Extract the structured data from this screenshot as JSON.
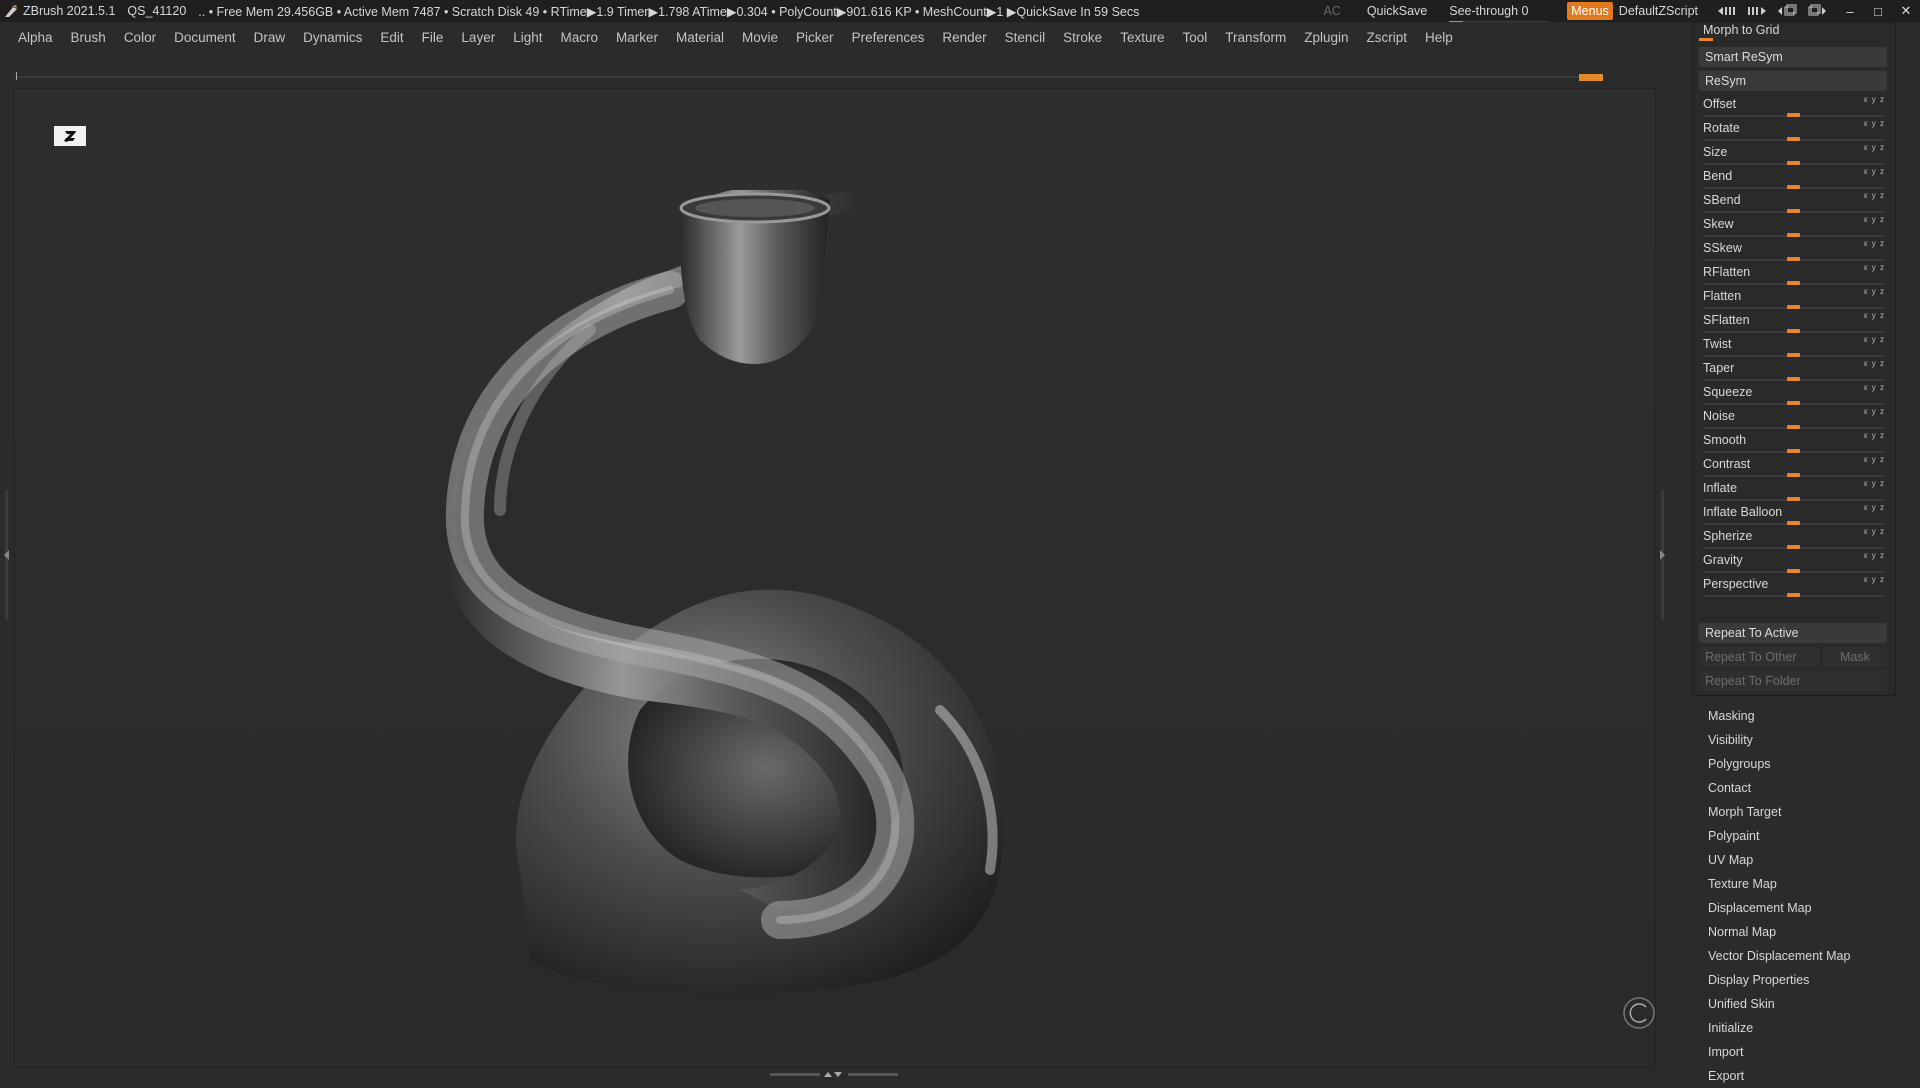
{
  "titlebar": {
    "app": "ZBrush 2021.5.1",
    "qs": "QS_41120",
    "stats": ".. • Free Mem 29.456GB • Active Mem 7487 • Scratch Disk 49 •  RTime▶1.9 Timer▶1.798 ATime▶0.304 • PolyCount▶901.616 KP  • MeshCount▶1  ▶QuickSave In 59 Secs",
    "ac": "AC",
    "quicksave": "QuickSave",
    "seethrough": "See-through  0",
    "menus": "Menus",
    "default_zscript": "DefaultZScript",
    "win_min": "–",
    "win_max": "□",
    "win_close": "✕"
  },
  "menubar": [
    "Alpha",
    "Brush",
    "Color",
    "Document",
    "Draw",
    "Dynamics",
    "Edit",
    "File",
    "Layer",
    "Light",
    "Macro",
    "Marker",
    "Material",
    "Movie",
    "Picker",
    "Preferences",
    "Render",
    "Stencil",
    "Stroke",
    "Texture",
    "Tool",
    "Transform",
    "Zplugin",
    "Zscript",
    "Help"
  ],
  "deformation": {
    "morph_to_grid": "Morph to Grid",
    "smart_resym": "Smart ReSym",
    "resym": "ReSym",
    "sliders": [
      {
        "name": "Offset",
        "value": 0
      },
      {
        "name": "Rotate",
        "value": 0
      },
      {
        "name": "Size",
        "value": 0
      },
      {
        "name": "Bend",
        "value": 0
      },
      {
        "name": "SBend",
        "value": 0
      },
      {
        "name": "Skew",
        "value": 0
      },
      {
        "name": "SSkew",
        "value": 0
      },
      {
        "name": "RFlatten",
        "value": 0
      },
      {
        "name": "Flatten",
        "value": 0
      },
      {
        "name": "SFlatten",
        "value": 0
      },
      {
        "name": "Twist",
        "value": 0
      },
      {
        "name": "Taper",
        "value": 0
      },
      {
        "name": "Squeeze",
        "value": 0
      },
      {
        "name": "Noise",
        "value": 0
      },
      {
        "name": "Smooth",
        "value": 0
      },
      {
        "name": "Contrast",
        "value": 0
      },
      {
        "name": "Inflate",
        "value": 0
      },
      {
        "name": "Inflate Balloon",
        "value": 0
      },
      {
        "name": "Spherize",
        "value": 0
      },
      {
        "name": "Gravity",
        "value": 0
      },
      {
        "name": "Perspective",
        "value": 0
      }
    ],
    "repeat_to_active": "Repeat To Active",
    "repeat_to_other": "Repeat To Other",
    "mask": "Mask",
    "repeat_to_folder": "Repeat To Folder"
  },
  "subpalettes": [
    "Masking",
    "Visibility",
    "Polygroups",
    "Contact",
    "Morph Target",
    "Polypaint",
    "UV Map",
    "Texture Map",
    "Displacement Map",
    "Normal Map",
    "Vector Displacement Map",
    "Display Properties",
    "Unified Skin",
    "Initialize",
    "Import",
    "Export"
  ],
  "colors": {
    "accent": "#e58a2c",
    "menus_button": "#e07a1f",
    "background": "#2b2b2b"
  }
}
